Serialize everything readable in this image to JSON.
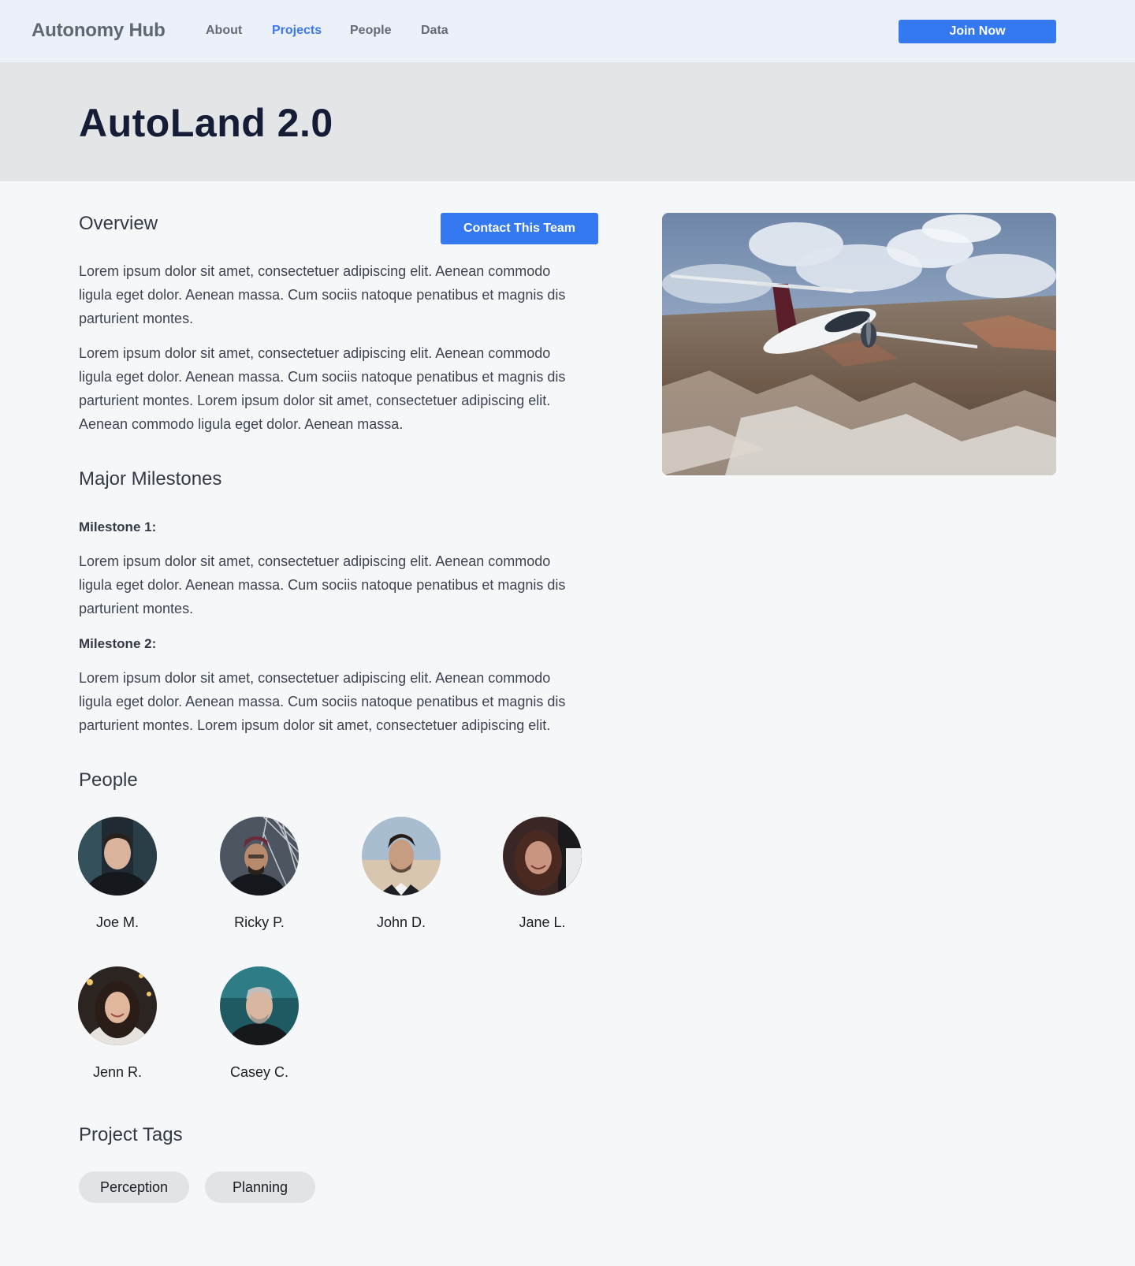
{
  "nav": {
    "brand": "Autonomy Hub",
    "links": [
      {
        "label": "About",
        "active": false
      },
      {
        "label": "Projects",
        "active": true
      },
      {
        "label": "People",
        "active": false
      },
      {
        "label": "Data",
        "active": false
      }
    ],
    "join_label": "Join Now"
  },
  "hero": {
    "title": "AutoLand 2.0"
  },
  "overview": {
    "title": "Overview",
    "contact_label": "Contact This Team",
    "paragraphs": [
      "Lorem ipsum dolor sit amet, consectetuer adipiscing elit. Aenean commodo ligula eget dolor. Aenean massa. Cum sociis natoque penatibus et magnis dis parturient montes.",
      "Lorem ipsum dolor sit amet, consectetuer adipiscing elit. Aenean commodo ligula eget dolor. Aenean massa. Cum sociis natoque penatibus et magnis dis parturient montes. Lorem ipsum dolor sit amet, consectetuer adipiscing elit. Aenean commodo ligula eget dolor. Aenean massa."
    ]
  },
  "milestones": {
    "title": "Major Milestones",
    "items": [
      {
        "label": "Milestone 1:",
        "text": "Lorem ipsum dolor sit amet, consectetuer adipiscing elit. Aenean commodo ligula eget dolor. Aenean massa. Cum sociis natoque penatibus et magnis dis parturient montes."
      },
      {
        "label": "Milestone 2:",
        "text": "Lorem ipsum dolor sit amet, consectetuer adipiscing elit. Aenean commodo ligula eget dolor. Aenean massa. Cum sociis natoque penatibus et magnis dis parturient montes. Lorem ipsum dolor sit amet, consectetuer adipiscing elit."
      }
    ]
  },
  "people": {
    "title": "People",
    "members": [
      {
        "name": "Joe M."
      },
      {
        "name": "Ricky P."
      },
      {
        "name": "John D."
      },
      {
        "name": "Jane L."
      },
      {
        "name": "Jenn R."
      },
      {
        "name": "Casey C."
      }
    ]
  },
  "tags": {
    "title": "Project Tags",
    "items": [
      "Perception",
      "Planning"
    ]
  },
  "colors": {
    "accent": "#3479f0",
    "nav_bg": "#ecf0f8",
    "hero_bg": "#e4e5e7",
    "page_bg": "#f6f7f9",
    "tag_bg": "#e2e3e5",
    "title_text": "#141c36"
  }
}
